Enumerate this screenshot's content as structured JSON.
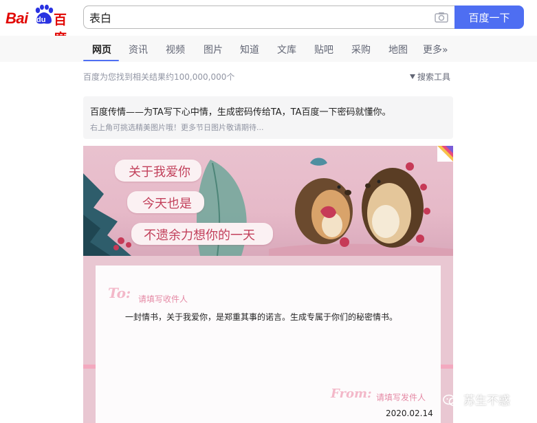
{
  "logo": {
    "bai": "Bai",
    "du": "du",
    "cn": "百度"
  },
  "search": {
    "value": "表白",
    "button_label": "百度一下"
  },
  "tabs": [
    {
      "label": "网页",
      "active": true
    },
    {
      "label": "资讯"
    },
    {
      "label": "视频"
    },
    {
      "label": "图片"
    },
    {
      "label": "知道"
    },
    {
      "label": "文库"
    },
    {
      "label": "贴吧"
    },
    {
      "label": "采购"
    },
    {
      "label": "地图"
    },
    {
      "label": "更多»"
    }
  ],
  "results": {
    "count_text": "百度为您找到相关结果约100,000,000个",
    "tools_label": "搜索工具"
  },
  "love_card": {
    "title": "百度传情——为TA写下心中情，生成密码传给TA，TA百度一下密码就懂你。",
    "subtitle": "右上角可挑选精美图片哦！更多节日图片敬请期待...",
    "banner_lines": [
      "关于我爱你",
      "今天也是",
      "不遗余力想你的一天"
    ],
    "to_label": "To:",
    "to_placeholder": "请填写收件人",
    "body": "一封情书，关于我爱你，是郑重其事的诺言。生成专属于你们的秘密情书。",
    "from_label": "From:",
    "from_placeholder": "请填写发件人",
    "date": "2020.02.14"
  },
  "watermark": {
    "text": "苏生不惑"
  },
  "colors": {
    "brand_red": "#e10602",
    "brand_blue": "#4e6ef2",
    "pink_text": "#c2405b"
  }
}
